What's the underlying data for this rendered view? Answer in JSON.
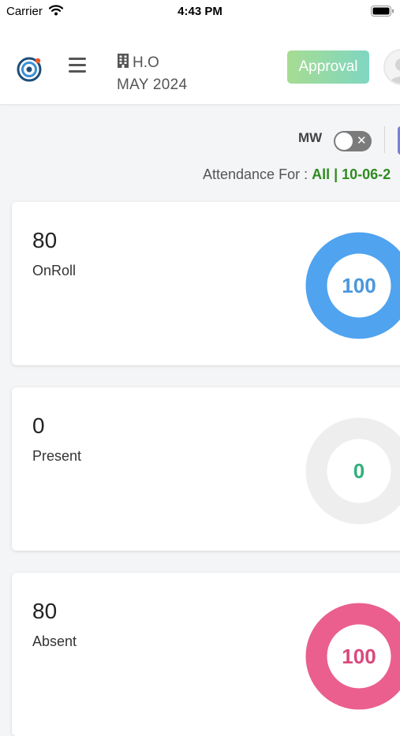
{
  "status_bar": {
    "carrier": "Carrier",
    "time": "4:43 PM"
  },
  "header": {
    "org_name": "H.O",
    "period": "MAY 2024",
    "approval_label": "Approval",
    "icons": [
      "target-logo-icon",
      "menu-icon",
      "building-icon",
      "user-avatar-icon"
    ]
  },
  "filters": {
    "mw_label": "MW",
    "mw_on": false,
    "attendance_prefix": "Attendance For : ",
    "attendance_value": "All | 10-06-2"
  },
  "cards": [
    {
      "count": "80",
      "label": "OnRoll",
      "percent_label": "100",
      "percent": 100,
      "ring_color": "#4fa3ef",
      "text_color": "#4a97dc"
    },
    {
      "count": "0",
      "label": "Present",
      "percent_label": "0",
      "percent": 0,
      "ring_color": "#3cc48e",
      "text_color": "#2fb07c"
    },
    {
      "count": "80",
      "label": "Absent",
      "percent_label": "100",
      "percent": 100,
      "ring_color": "#ea5f8e",
      "text_color": "#d9497c"
    }
  ],
  "colors": {
    "track": "#eeeeee",
    "accent_green": "#2e8b1e"
  }
}
